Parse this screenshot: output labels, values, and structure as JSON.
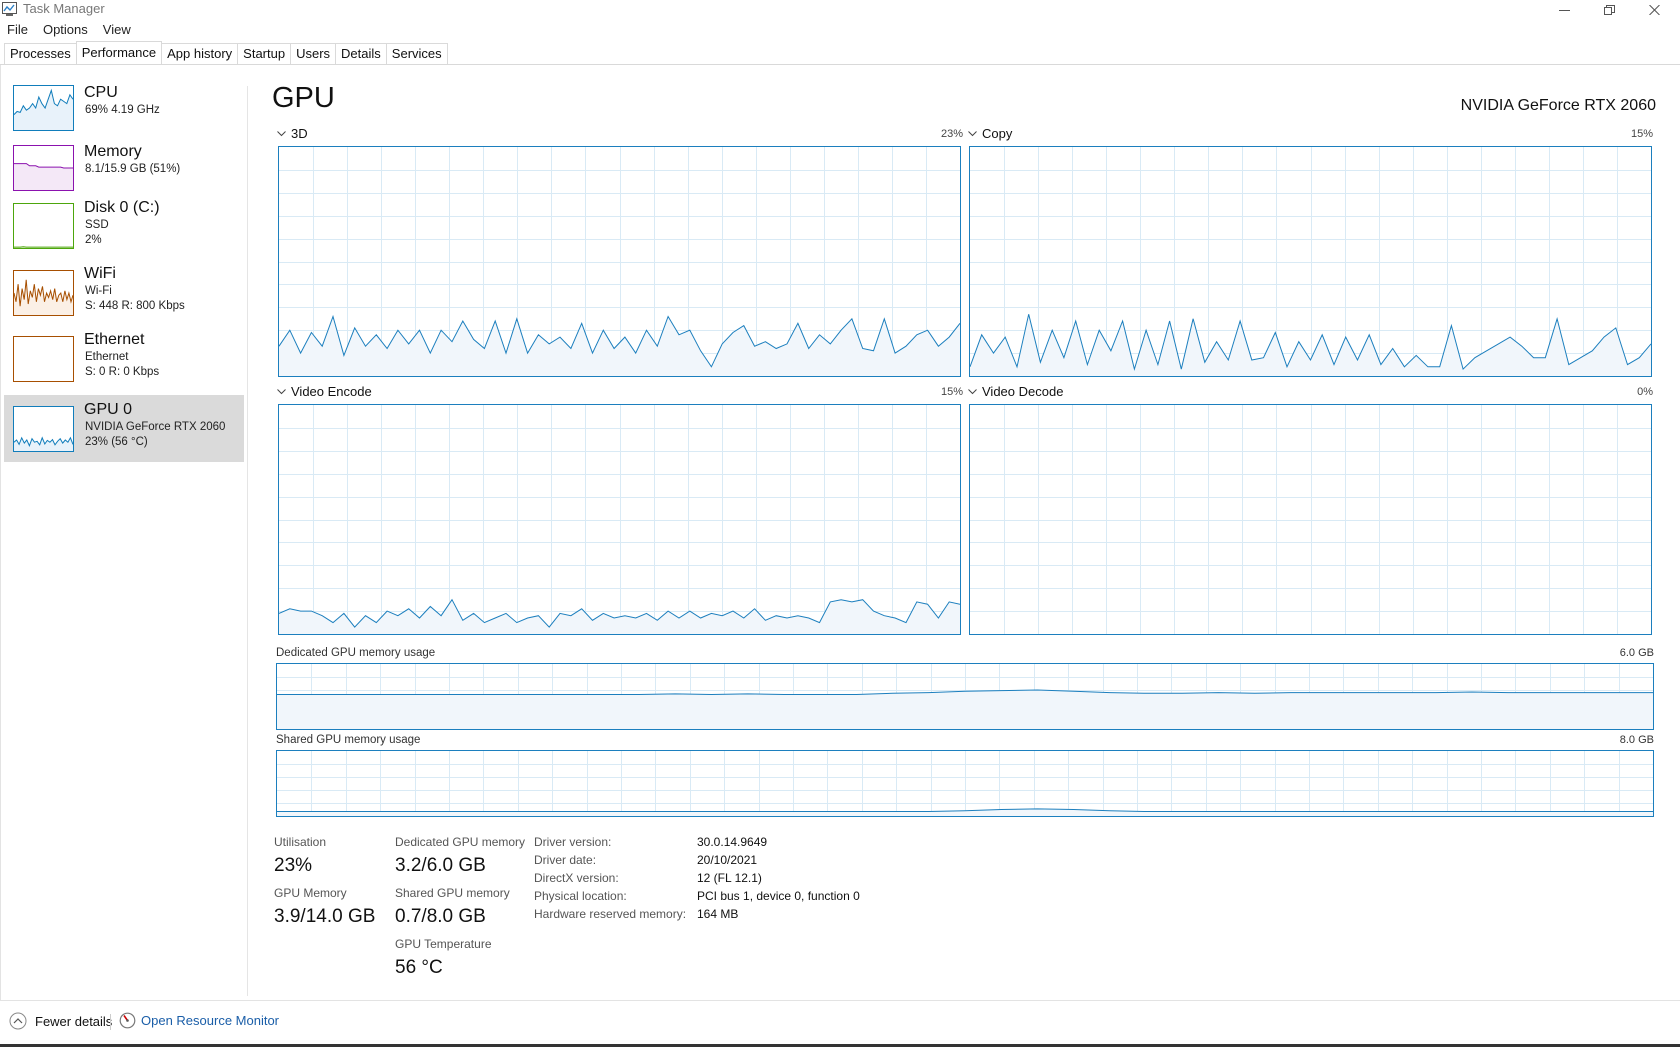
{
  "window": {
    "title": "Task Manager"
  },
  "menu": [
    "File",
    "Options",
    "View"
  ],
  "tabs": [
    "Processes",
    "Performance",
    "App history",
    "Startup",
    "Users",
    "Details",
    "Services"
  ],
  "active_tab": "Performance",
  "sidebar": {
    "cpu": {
      "name": "CPU",
      "line1": "69%  4.19 GHz"
    },
    "memory": {
      "name": "Memory",
      "line1": "8.1/15.9 GB (51%)"
    },
    "disk": {
      "name": "Disk 0 (C:)",
      "line1": "SSD",
      "line2": "2%"
    },
    "wifi": {
      "name": "WiFi",
      "line1": "Wi-Fi",
      "line2": "S: 448  R: 800 Kbps"
    },
    "ethernet": {
      "name": "Ethernet",
      "line1": "Ethernet",
      "line2": "S: 0  R: 0 Kbps"
    },
    "gpu": {
      "name": "GPU 0",
      "line1": "NVIDIA GeForce RTX 2060",
      "line2": "23%  (56 °C)"
    }
  },
  "main": {
    "title": "GPU",
    "model": "NVIDIA GeForce RTX 2060",
    "graphs": {
      "g3d": {
        "label": "3D",
        "percent": "23%"
      },
      "copy": {
        "label": "Copy",
        "percent": "15%"
      },
      "encode": {
        "label": "Video Encode",
        "percent": "15%"
      },
      "decode": {
        "label": "Video Decode",
        "percent": "0%"
      }
    },
    "dedicated_usage": {
      "label": "Dedicated GPU memory usage",
      "max": "6.0 GB"
    },
    "shared_usage": {
      "label": "Shared GPU memory usage",
      "max": "8.0 GB"
    }
  },
  "stats": {
    "utilisation": {
      "label": "Utilisation",
      "value": "23%"
    },
    "gpu_memory": {
      "label": "GPU Memory",
      "value": "3.9/14.0 GB"
    },
    "dedicated_memory": {
      "label": "Dedicated GPU memory",
      "value": "3.2/6.0 GB"
    },
    "shared_memory": {
      "label": "Shared GPU memory",
      "value": "0.7/8.0 GB"
    },
    "temperature": {
      "label": "GPU Temperature",
      "value": "56 °C"
    }
  },
  "info": {
    "driver_version": {
      "label": "Driver version:",
      "value": "30.0.14.9649"
    },
    "driver_date": {
      "label": "Driver date:",
      "value": "20/10/2021"
    },
    "directx": {
      "label": "DirectX version:",
      "value": "12 (FL 12.1)"
    },
    "location": {
      "label": "Physical location:",
      "value": "PCI bus 1, device 0, function 0"
    },
    "reserved": {
      "label": "Hardware reserved memory:",
      "value": "164 MB"
    }
  },
  "footer": {
    "fewer_details": "Fewer details",
    "resource_monitor": "Open Resource Monitor"
  },
  "colors": {
    "gpu_line": "#1c7fbe",
    "gpu_fill": "#f1f6fb",
    "grid": "#d9eaf5",
    "cpu": "#117dbb",
    "memory": "#8b12ae",
    "disk": "#4da60c",
    "network": "#a74f01",
    "selected_bg": "#dadada"
  },
  "series": {
    "g3d": [
      0.13,
      0.2,
      0.1,
      0.19,
      0.13,
      0.26,
      0.09,
      0.21,
      0.13,
      0.18,
      0.12,
      0.2,
      0.14,
      0.2,
      0.1,
      0.2,
      0.15,
      0.24,
      0.16,
      0.12,
      0.24,
      0.1,
      0.25,
      0.1,
      0.18,
      0.14,
      0.17,
      0.12,
      0.23,
      0.1,
      0.2,
      0.12,
      0.17,
      0.1,
      0.2,
      0.13,
      0.26,
      0.18,
      0.2,
      0.11,
      0.04,
      0.14,
      0.19,
      0.22,
      0.13,
      0.15,
      0.12,
      0.14,
      0.23,
      0.12,
      0.18,
      0.14,
      0.2,
      0.25,
      0.12,
      0.11,
      0.25,
      0.1,
      0.13,
      0.18,
      0.2,
      0.13,
      0.17,
      0.23
    ],
    "copy": [
      0.04,
      0.18,
      0.1,
      0.17,
      0.04,
      0.27,
      0.06,
      0.2,
      0.08,
      0.24,
      0.05,
      0.2,
      0.11,
      0.24,
      0.03,
      0.2,
      0.05,
      0.24,
      0.03,
      0.25,
      0.06,
      0.15,
      0.07,
      0.24,
      0.07,
      0.08,
      0.19,
      0.04,
      0.15,
      0.07,
      0.18,
      0.05,
      0.17,
      0.07,
      0.18,
      0.05,
      0.12,
      0.04,
      0.09,
      0.04,
      0.04,
      0.22,
      0.03,
      0.08,
      0.11,
      0.14,
      0.17,
      0.13,
      0.08,
      0.08,
      0.25,
      0.05,
      0.08,
      0.11,
      0.17,
      0.21,
      0.05,
      0.08,
      0.14
    ],
    "encode": [
      0.09,
      0.11,
      0.1,
      0.1,
      0.08,
      0.05,
      0.09,
      0.03,
      0.08,
      0.05,
      0.1,
      0.08,
      0.11,
      0.07,
      0.12,
      0.08,
      0.15,
      0.06,
      0.09,
      0.05,
      0.07,
      0.09,
      0.05,
      0.07,
      0.08,
      0.03,
      0.09,
      0.08,
      0.11,
      0.06,
      0.09,
      0.07,
      0.08,
      0.07,
      0.09,
      0.06,
      0.1,
      0.07,
      0.1,
      0.07,
      0.09,
      0.08,
      0.1,
      0.07,
      0.11,
      0.06,
      0.08,
      0.07,
      0.08,
      0.07,
      0.05,
      0.14,
      0.15,
      0.14,
      0.15,
      0.1,
      0.08,
      0.07,
      0.05,
      0.14,
      0.13,
      0.07,
      0.14,
      0.13
    ],
    "dedicated": [
      0.53,
      0.53,
      0.53,
      0.53,
      0.53,
      0.53,
      0.53,
      0.53,
      0.53,
      0.53,
      0.53,
      0.54,
      0.53,
      0.54,
      0.53,
      0.53,
      0.53,
      0.55,
      0.56,
      0.58,
      0.59,
      0.6,
      0.58,
      0.56,
      0.55,
      0.55,
      0.56,
      0.55,
      0.56,
      0.56,
      0.56,
      0.56,
      0.56,
      0.57,
      0.56,
      0.56,
      0.56,
      0.56,
      0.56
    ],
    "shared": [
      0.07,
      0.07,
      0.07,
      0.07,
      0.07,
      0.07,
      0.07,
      0.07,
      0.07,
      0.07,
      0.07,
      0.07,
      0.07,
      0.07,
      0.07,
      0.07,
      0.07,
      0.07,
      0.07,
      0.08,
      0.1,
      0.11,
      0.1,
      0.08,
      0.07,
      0.07,
      0.07,
      0.07,
      0.07,
      0.07,
      0.07,
      0.07,
      0.07,
      0.07,
      0.07,
      0.07,
      0.07,
      0.07,
      0.07
    ],
    "cpu_thumb": [
      0.35,
      0.42,
      0.4,
      0.55,
      0.45,
      0.5,
      0.6,
      0.5,
      0.75,
      0.6,
      0.5,
      0.7,
      0.9,
      0.6,
      0.55,
      0.7,
      0.65,
      0.6,
      0.8,
      0.7
    ],
    "mem_thumb": [
      0.6,
      0.6,
      0.6,
      0.6,
      0.6,
      0.55,
      0.55,
      0.55,
      0.52,
      0.52,
      0.52,
      0.52,
      0.52,
      0.52,
      0.52,
      0.52,
      0.5,
      0.5,
      0.5,
      0.5
    ],
    "disk_thumb": [
      0.02,
      0.02,
      0.02,
      0.03,
      0.02,
      0.02,
      0.02,
      0.02,
      0.02,
      0.02,
      0.02,
      0.02,
      0.02,
      0.02,
      0.02,
      0.02,
      0.02,
      0.02,
      0.02,
      0.02
    ],
    "wifi_thumb": [
      0.5,
      0.3,
      0.7,
      0.2,
      0.6,
      0.35,
      0.8,
      0.25,
      0.55,
      0.4,
      0.7,
      0.3,
      0.6,
      0.45,
      0.65,
      0.3,
      0.5,
      0.4,
      0.55,
      0.35,
      0.6,
      0.3,
      0.45,
      0.5,
      0.3,
      0.55,
      0.35,
      0.5,
      0.3,
      0.45
    ],
    "gpu_thumb": [
      0.2,
      0.25,
      0.15,
      0.3,
      0.18,
      0.25,
      0.12,
      0.28,
      0.2,
      0.22,
      0.14,
      0.3,
      0.16,
      0.24,
      0.2,
      0.26,
      0.14,
      0.22,
      0.28,
      0.18,
      0.25,
      0.2,
      0.3,
      0.15
    ]
  }
}
